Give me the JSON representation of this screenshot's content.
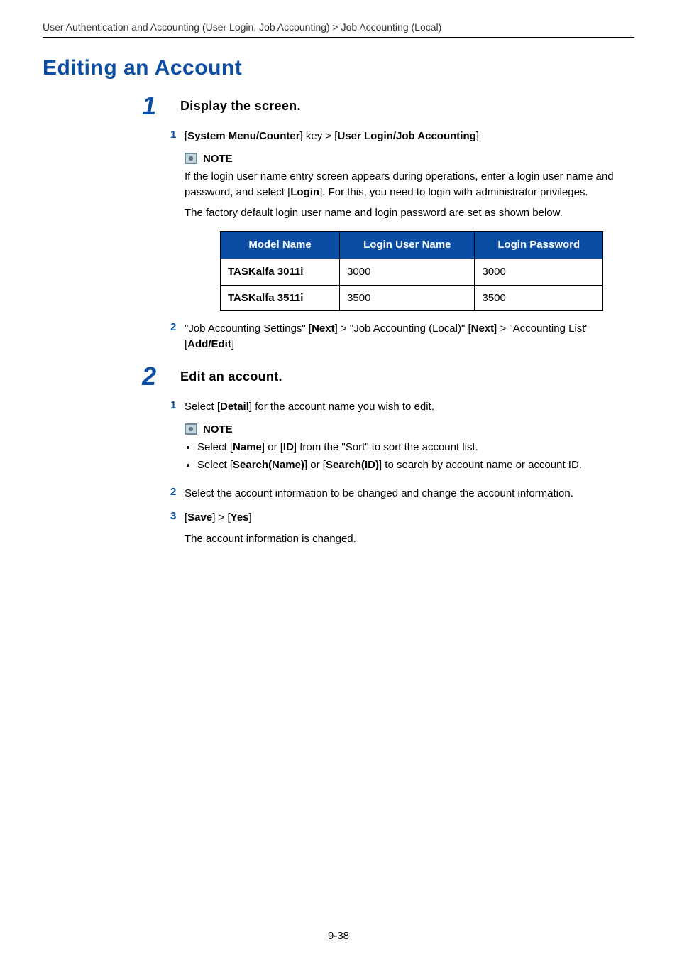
{
  "breadcrumb": "User Authentication and Accounting (User Login, Job Accounting) > Job Accounting (Local)",
  "title": "Editing an Account",
  "section1": {
    "number": "1",
    "heading": "Display the screen.",
    "step1": {
      "num": "1",
      "t1": "[",
      "b1": "System Menu/Counter",
      "t2": "] key > [",
      "b2": "User Login/Job Accounting",
      "t3": "]"
    },
    "note1": {
      "label": "NOTE",
      "p1a": "If the login user name entry screen appears during operations, enter a login user name and password, and select [",
      "p1b": "Login",
      "p1c": "]. For this, you need to login with administrator privileges.",
      "p2": "The factory default login user name and login password are set as shown below."
    },
    "table": {
      "headers": {
        "model": "Model Name",
        "user": "Login User Name",
        "pass": "Login Password"
      },
      "rows": [
        {
          "model": "TASKalfa 3011i",
          "user": "3000",
          "pass": "3000"
        },
        {
          "model": "TASKalfa 3511i",
          "user": "3500",
          "pass": "3500"
        }
      ]
    },
    "step2": {
      "num": "2",
      "t1": "\"Job Accounting Settings\" [",
      "b1": "Next",
      "t2": "] > \"Job Accounting (Local)\" [",
      "b2": "Next",
      "t3": "] > \"Accounting List\" [",
      "b3": "Add/Edit",
      "t4": "]"
    }
  },
  "section2": {
    "number": "2",
    "heading": "Edit an account.",
    "step1": {
      "num": "1",
      "t1": "Select [",
      "b1": "Detail",
      "t2": "] for the account name you wish to edit."
    },
    "note1": {
      "label": "NOTE",
      "li1": {
        "t1": "Select [",
        "b1": "Name",
        "t2": "] or [",
        "b2": "ID",
        "t3": "] from the \"Sort\" to sort the account list."
      },
      "li2": {
        "t1": "Select [",
        "b1": "Search(Name)",
        "t2": "] or [",
        "b2": "Search(ID)",
        "t3": "] to search by account name or account ID."
      }
    },
    "step2": {
      "num": "2",
      "text": "Select the account information to be changed and change the account information."
    },
    "step3": {
      "num": "3",
      "t1": "[",
      "b1": "Save",
      "t2": "] > [",
      "b2": "Yes",
      "t3": "]",
      "after": "The account information is changed."
    }
  },
  "page_number": "9-38"
}
